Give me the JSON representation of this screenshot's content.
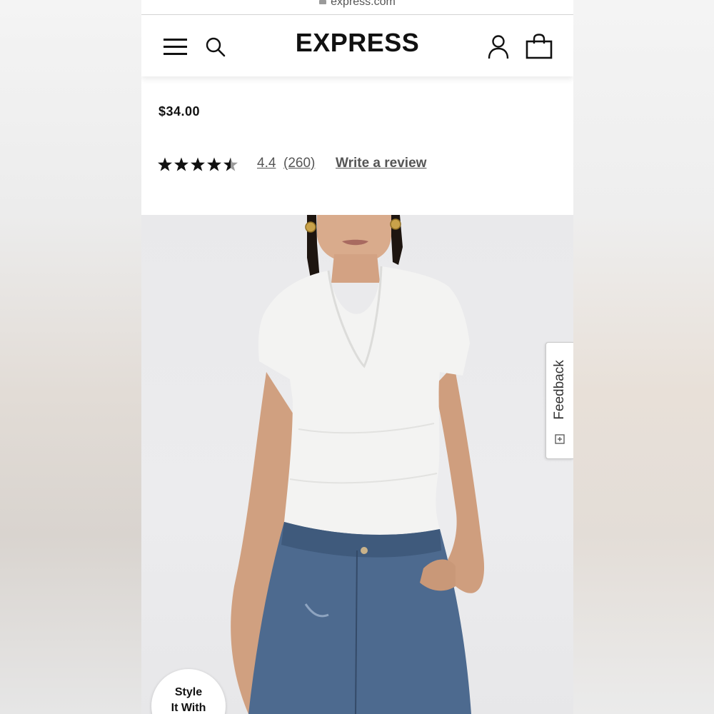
{
  "browser": {
    "url": "express.com"
  },
  "header": {
    "logo": "EXPRESS",
    "icons": {
      "menu": "menu-icon",
      "search": "search-icon",
      "account": "account-icon",
      "bag": "shopping-bag-icon"
    }
  },
  "product": {
    "price": "$34.00",
    "rating": {
      "stars": 4.4,
      "max_stars": 5,
      "value": "4.4",
      "count": "(260)"
    },
    "write_review": "Write a review"
  },
  "feedback_tab": {
    "label": "Feedback",
    "icon": "feedback-icon"
  },
  "style_badge": {
    "line1": "Style",
    "line2": "It With"
  },
  "colors": {
    "text": "#111111",
    "link": "#555555",
    "background": "#ffffff",
    "photo_bg": "#ebebed"
  }
}
